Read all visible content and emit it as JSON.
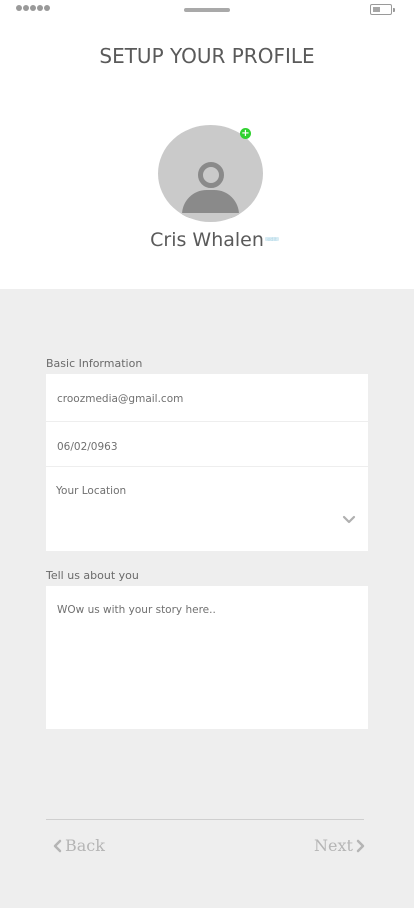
{
  "status_bar": {
    "signal_icon": "signal-dots-icon",
    "battery_icon": "battery-icon",
    "battery_level": 0.45
  },
  "header": {
    "title": "SETUP YOUR PROFILE"
  },
  "profile": {
    "name": "Cris Whalen",
    "avatar_icon": "user-avatar-icon",
    "add_photo_icon": "plus-icon",
    "edit_icon": "edit-icon",
    "add_color": "#2fd12f"
  },
  "basic_info": {
    "label": "Basic Information",
    "email_value": "croozmedia@gmail.com",
    "dob_value": "06/02/0963",
    "location_placeholder": "Your Location"
  },
  "about": {
    "label": "Tell us about you",
    "placeholder": "WOw us with your story here.."
  },
  "navigation": {
    "back_label": "Back",
    "next_label": "Next"
  }
}
